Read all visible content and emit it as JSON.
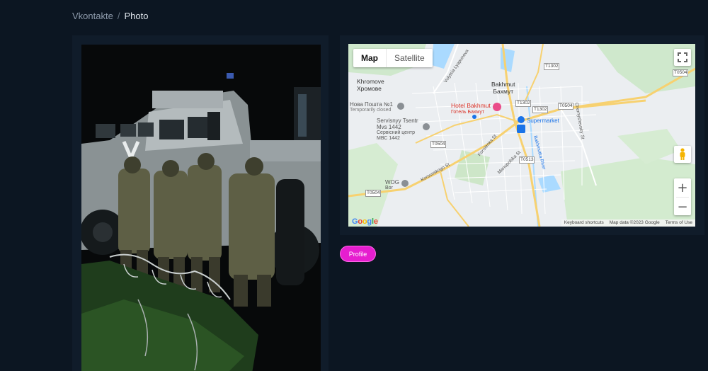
{
  "breadcrumb": {
    "parent": "Vkontakte",
    "separator": "/",
    "current": "Photo"
  },
  "map": {
    "type_map": "Map",
    "type_satellite": "Satellite",
    "zoom_in": "+",
    "zoom_out": "−",
    "labels": {
      "khromove_en": "Khromove",
      "khromove_local": "Хромове",
      "nova_poshta": "Нова Пошта №1",
      "nova_poshta_status": "Temporarily closed",
      "servisnyy_en": "Servisnyy Tsentr",
      "servisnyy_en2": "Mvs 1442",
      "servisnyy_local": "Сервісний центр",
      "servisnyy_local2": "МВС 1442",
      "wog_en": "WOG",
      "wog_local": "Вог",
      "bakhmut_en": "Bakhmut",
      "bakhmut_local": "Бахмут",
      "hotel_en": "Hotel Bakhmut",
      "hotel_local": "Готель Бахмут",
      "supermarket": "Supermarket",
      "street_vulytsia": "Vulytsia Lyapunova",
      "street_korolenka": "Korolenka St",
      "street_mariupolska": "Mariupolska St",
      "street_korsunskogo": "Korsunskogo St",
      "street_bakhmutka": "Bakhmutka River",
      "street_chernyshevsky": "Chernyshevsky St"
    },
    "roads": {
      "t1302a": "T1302",
      "t1302b": "T1302",
      "t1302c": "T1302",
      "t0504a": "T0504",
      "t0504b": "T0504",
      "t0504c": "T0504",
      "t0504d": "T0504",
      "t0513": "T0513"
    },
    "attribution": {
      "shortcuts": "Keyboard shortcuts",
      "data": "Map data ©2023 Google",
      "terms": "Terms of Use"
    },
    "logo": {
      "g1": "G",
      "o1": "o",
      "o2": "o",
      "g2": "g",
      "l": "l",
      "e": "e"
    }
  },
  "profile_button": "Profile",
  "colors": {
    "accent": "#e61ecf",
    "background": "#0c1622",
    "card": "#101c2a"
  }
}
